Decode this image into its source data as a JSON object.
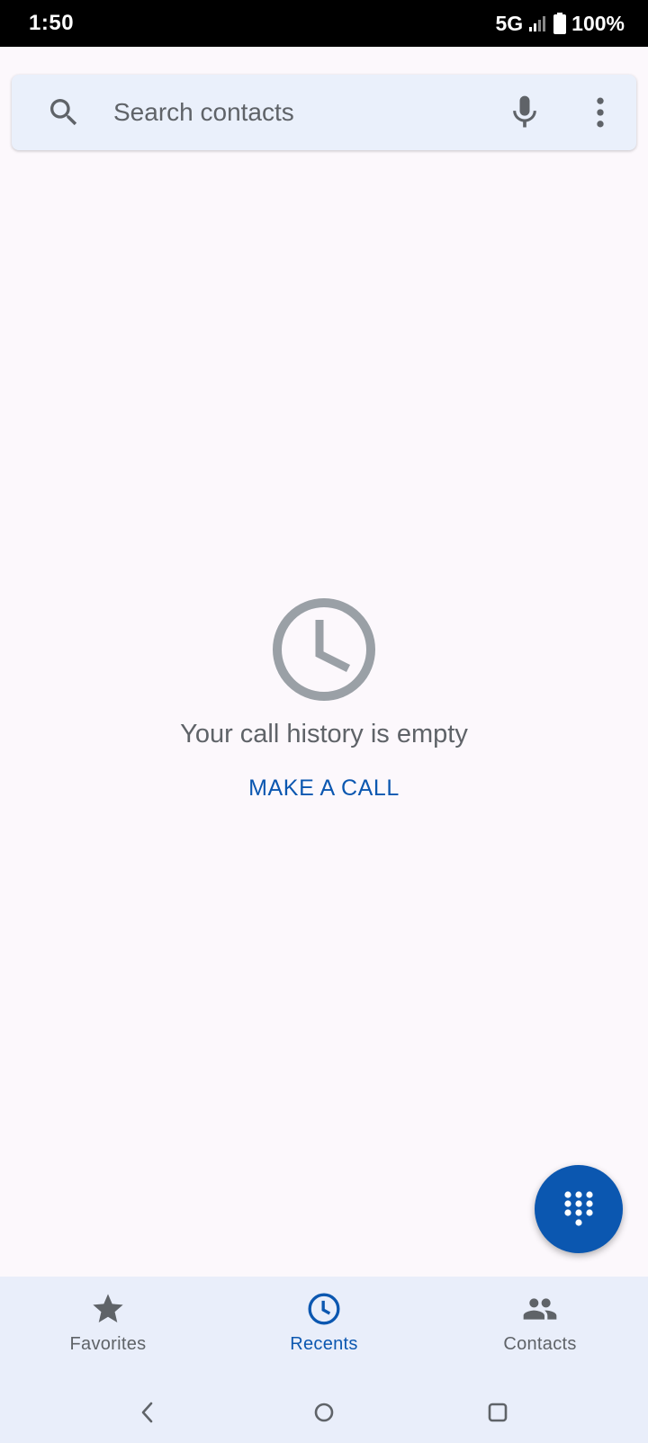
{
  "status_bar": {
    "time": "1:50",
    "network": "5G",
    "battery": "100%"
  },
  "search": {
    "placeholder": "Search contacts"
  },
  "empty_state": {
    "message": "Your call history is empty",
    "action_label": "MAKE A CALL"
  },
  "bottom_nav": {
    "items": [
      {
        "label": "Favorites",
        "icon": "star-icon",
        "active": false
      },
      {
        "label": "Recents",
        "icon": "clock-icon",
        "active": true
      },
      {
        "label": "Contacts",
        "icon": "people-icon",
        "active": false
      }
    ]
  },
  "colors": {
    "accent": "#0b57b0",
    "background": "#fcf8fc",
    "search_bg": "#eaf0fb",
    "nav_bg": "#e9eefa",
    "muted_text": "#5f6368",
    "empty_icon": "#9aa0a6"
  }
}
